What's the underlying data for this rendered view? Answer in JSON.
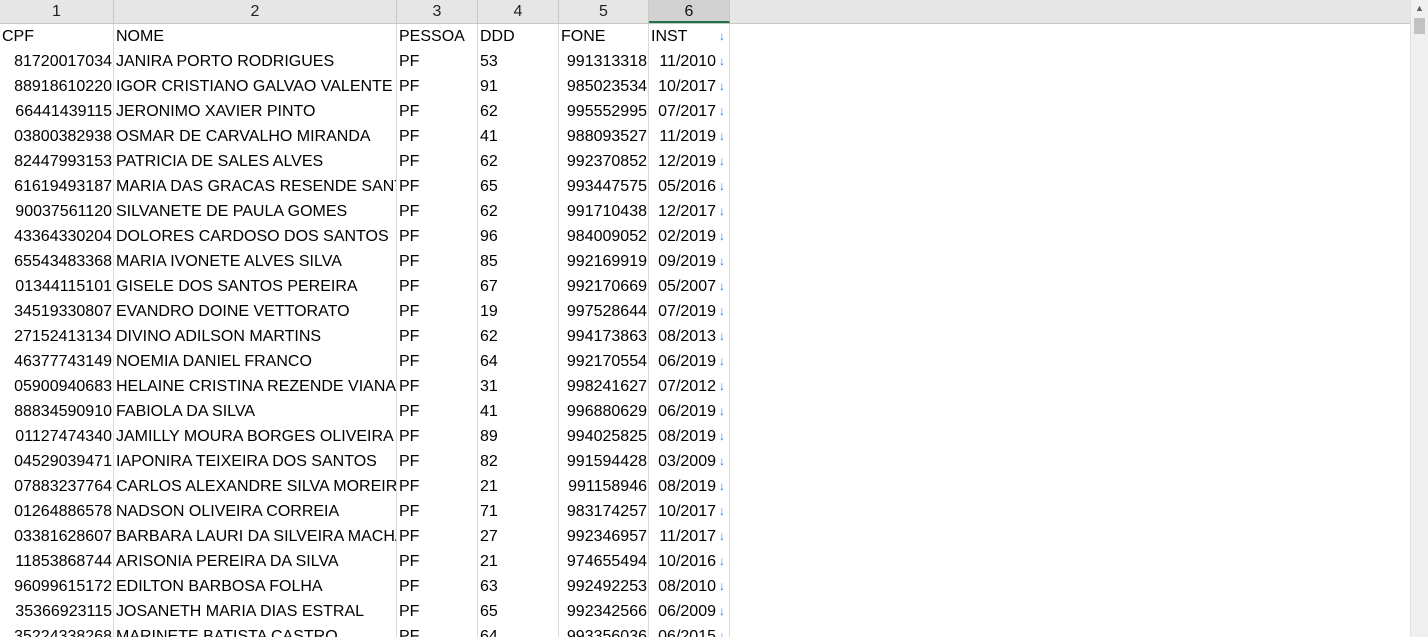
{
  "columns": [
    {
      "label": "1",
      "selected": false
    },
    {
      "label": "2",
      "selected": false
    },
    {
      "label": "3",
      "selected": false
    },
    {
      "label": "4",
      "selected": false
    },
    {
      "label": "5",
      "selected": false
    },
    {
      "label": "6",
      "selected": true
    }
  ],
  "header": {
    "cpf": "CPF",
    "nome": "NOME",
    "pessoa": "PESSOA",
    "ddd": "DDD",
    "fone": "FONE",
    "inst": "INST"
  },
  "dropdown_icon": "arrow-down-icon",
  "rows": [
    {
      "cpf": "81720017034",
      "nome": "JANIRA PORTO RODRIGUES",
      "pessoa": "PF",
      "ddd": "53",
      "fone": "991313318",
      "inst": "11/2010"
    },
    {
      "cpf": "88918610220",
      "nome": "IGOR CRISTIANO GALVAO VALENTE",
      "pessoa": "PF",
      "ddd": "91",
      "fone": "985023534",
      "inst": "10/2017"
    },
    {
      "cpf": "66441439115",
      "nome": "JERONIMO XAVIER PINTO",
      "pessoa": "PF",
      "ddd": "62",
      "fone": "995552995",
      "inst": "07/2017"
    },
    {
      "cpf": "03800382938",
      "nome": "OSMAR DE CARVALHO MIRANDA",
      "pessoa": "PF",
      "ddd": "41",
      "fone": "988093527",
      "inst": "11/2019"
    },
    {
      "cpf": "82447993153",
      "nome": "PATRICIA DE SALES ALVES",
      "pessoa": "PF",
      "ddd": "62",
      "fone": "992370852",
      "inst": "12/2019"
    },
    {
      "cpf": "61619493187",
      "nome": "MARIA DAS GRACAS RESENDE SANT",
      "pessoa": "PF",
      "ddd": "65",
      "fone": "993447575",
      "inst": "05/2016"
    },
    {
      "cpf": "90037561120",
      "nome": "SILVANETE DE PAULA GOMES",
      "pessoa": "PF",
      "ddd": "62",
      "fone": "991710438",
      "inst": "12/2017"
    },
    {
      "cpf": "43364330204",
      "nome": "DOLORES CARDOSO DOS SANTOS",
      "pessoa": "PF",
      "ddd": "96",
      "fone": "984009052",
      "inst": "02/2019"
    },
    {
      "cpf": "65543483368",
      "nome": "MARIA IVONETE ALVES SILVA",
      "pessoa": "PF",
      "ddd": "85",
      "fone": "992169919",
      "inst": "09/2019"
    },
    {
      "cpf": "01344115101",
      "nome": "GISELE DOS SANTOS PEREIRA",
      "pessoa": "PF",
      "ddd": "67",
      "fone": "992170669",
      "inst": "05/2007"
    },
    {
      "cpf": "34519330807",
      "nome": "EVANDRO DOINE VETTORATO",
      "pessoa": "PF",
      "ddd": "19",
      "fone": "997528644",
      "inst": "07/2019"
    },
    {
      "cpf": "27152413134",
      "nome": "DIVINO ADILSON MARTINS",
      "pessoa": "PF",
      "ddd": "62",
      "fone": "994173863",
      "inst": "08/2013"
    },
    {
      "cpf": "46377743149",
      "nome": "NOEMIA DANIEL FRANCO",
      "pessoa": "PF",
      "ddd": "64",
      "fone": "992170554",
      "inst": "06/2019"
    },
    {
      "cpf": "05900940683",
      "nome": "HELAINE CRISTINA REZENDE VIANA",
      "pessoa": "PF",
      "ddd": "31",
      "fone": "998241627",
      "inst": "07/2012"
    },
    {
      "cpf": "88834590910",
      "nome": "FABIOLA DA SILVA",
      "pessoa": "PF",
      "ddd": "41",
      "fone": "996880629",
      "inst": "06/2019"
    },
    {
      "cpf": "01127474340",
      "nome": "JAMILLY MOURA BORGES OLIVEIRA",
      "pessoa": "PF",
      "ddd": "89",
      "fone": "994025825",
      "inst": "08/2019"
    },
    {
      "cpf": "04529039471",
      "nome": "IAPONIRA TEIXEIRA DOS SANTOS",
      "pessoa": "PF",
      "ddd": "82",
      "fone": "991594428",
      "inst": "03/2009"
    },
    {
      "cpf": "07883237764",
      "nome": "CARLOS ALEXANDRE SILVA MOREIRA",
      "pessoa": "PF",
      "ddd": "21",
      "fone": "991158946",
      "inst": "08/2019"
    },
    {
      "cpf": "01264886578",
      "nome": "NADSON OLIVEIRA CORREIA",
      "pessoa": "PF",
      "ddd": "71",
      "fone": "983174257",
      "inst": "10/2017"
    },
    {
      "cpf": "03381628607",
      "nome": "BARBARA LAURI DA SILVEIRA MACHADO",
      "pessoa": "PF",
      "ddd": "27",
      "fone": "992346957",
      "inst": "11/2017"
    },
    {
      "cpf": "11853868744",
      "nome": "ARISONIA PEREIRA DA SILVA",
      "pessoa": "PF",
      "ddd": "21",
      "fone": "974655494",
      "inst": "10/2016"
    },
    {
      "cpf": "96099615172",
      "nome": "EDILTON BARBOSA FOLHA",
      "pessoa": "PF",
      "ddd": "63",
      "fone": "992492253",
      "inst": "08/2010"
    },
    {
      "cpf": "35366923115",
      "nome": "JOSANETH MARIA DIAS ESTRAL",
      "pessoa": "PF",
      "ddd": "65",
      "fone": "992342566",
      "inst": "06/2009"
    },
    {
      "cpf": "35224338268",
      "nome": "MARINETE BATISTA CASTRO",
      "pessoa": "PF",
      "ddd": "64",
      "fone": "993356036",
      "inst": "06/2015"
    }
  ],
  "scrollbar": {
    "up_arrow_icon": "chevron-up-icon"
  }
}
